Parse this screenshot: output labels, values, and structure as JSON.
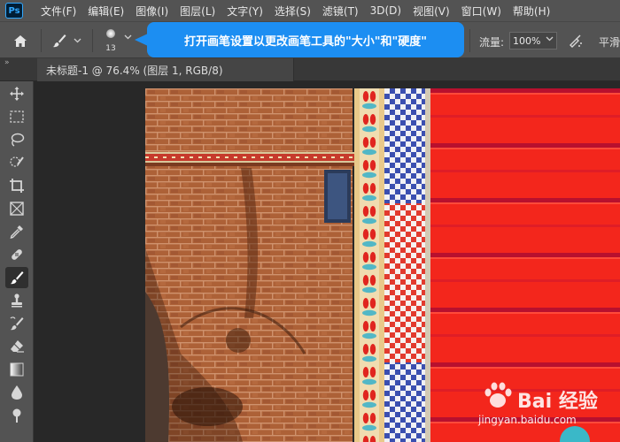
{
  "app": {
    "logo_text": "Ps"
  },
  "menu": [
    "文件(F)",
    "编辑(E)",
    "图像(I)",
    "图层(L)",
    "文字(Y)",
    "选择(S)",
    "滤镜(T)",
    "3D(D)",
    "视图(V)",
    "窗口(W)",
    "帮助(H)"
  ],
  "options_bar": {
    "brush_size": "13",
    "flow_label": "流量:",
    "flow_value": "100%",
    "smoothing_label": "平滑"
  },
  "tooltip": {
    "text": "打开画笔设置以更改画笔工具的\"大小\"和\"硬度\""
  },
  "document_tab": {
    "title": "未标题-1 @ 76.4% (图层 1, RGB/8)"
  },
  "panel_collapse_glyph": "»",
  "tools": [
    "move-tool",
    "marquee-tool",
    "lasso-tool",
    "quick-selection-tool",
    "crop-tool",
    "frame-tool",
    "eyedropper-tool",
    "healing-brush-tool",
    "brush-tool",
    "clone-stamp-tool",
    "history-brush-tool",
    "eraser-tool",
    "gradient-tool",
    "blur-tool",
    "dodge-tool"
  ],
  "active_tool": "brush-tool",
  "colors": {
    "accent": "#1c8ef2",
    "panel": "#535353",
    "workspace": "#282828",
    "brick": "#b9653a",
    "red_panel": "#f3261c"
  },
  "watermark": {
    "brand": "Bai 经验",
    "url": "jingyan.baidu.com"
  }
}
